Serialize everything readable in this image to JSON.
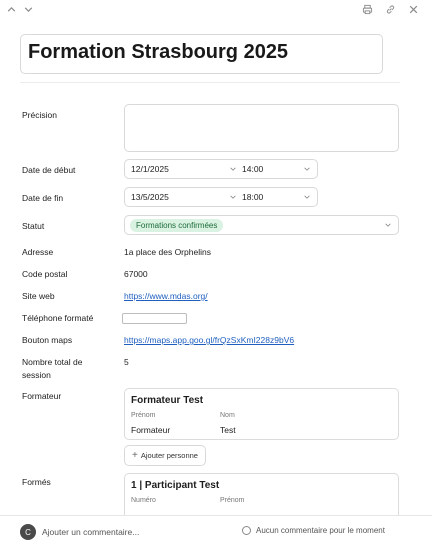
{
  "toolbar": {
    "icons": [
      "chevron-up-icon",
      "chevron-down-icon",
      "print-icon",
      "link-icon",
      "close-icon"
    ]
  },
  "title": "Formation Strasbourg 2025",
  "fields": {
    "precision": {
      "label": "Précision",
      "value": ""
    },
    "date_debut": {
      "label": "Date de début",
      "date": "12/1/2025",
      "time": "14:00"
    },
    "date_fin": {
      "label": "Date de fin",
      "date": "13/5/2025",
      "time": "18:00"
    },
    "statut": {
      "label": "Statut",
      "value": "Formations confirmées",
      "color": "#d9f2e1"
    },
    "adresse": {
      "label": "Adresse",
      "value": "1a place des Orphelins"
    },
    "code_postal": {
      "label": "Code postal",
      "value": "67000"
    },
    "site_web": {
      "label": "Site web",
      "value": "https://www.mdas.org/"
    },
    "telephone": {
      "label": "Téléphone formaté",
      "value": ""
    },
    "bouton_maps": {
      "label": "Bouton maps",
      "value": "https://maps.app.goo.gl/frQzSxKmI228z9bV6"
    },
    "nombre_session": {
      "label": "Nombre total de session",
      "value": "5"
    }
  },
  "formateur": {
    "label": "Formateur",
    "card_title": "Formateur Test",
    "col1_label": "Prénom",
    "col1_value": "Formateur",
    "col2_label": "Nom",
    "col2_value": "Test",
    "add_label": "Ajouter personne"
  },
  "formes": {
    "label": "Formés",
    "card_title": "1 | Participant Test",
    "col1_label": "Numéro",
    "col2_label": "Prénom"
  },
  "footer": {
    "avatar_initial": "C",
    "comment_placeholder": "Ajouter un commentaire...",
    "no_comment_text": "Aucun commentaire pour le moment"
  }
}
